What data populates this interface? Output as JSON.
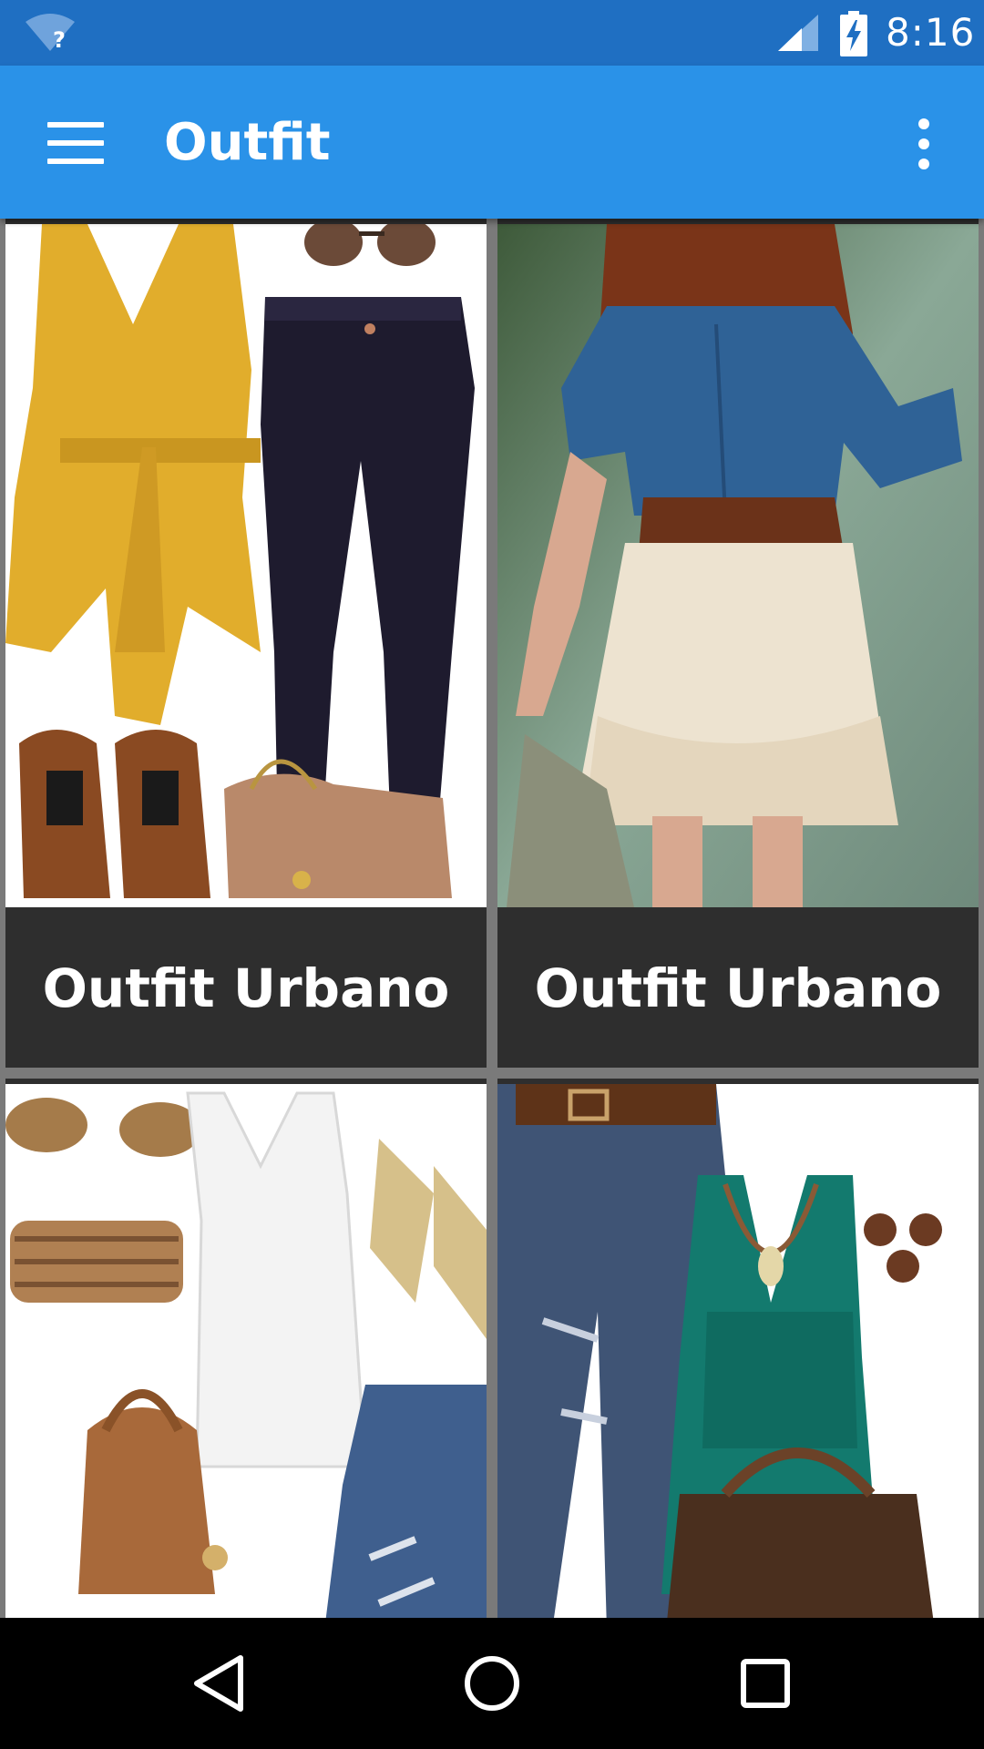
{
  "status_bar": {
    "time": "8:16",
    "icons": [
      "wifi-unknown-icon",
      "cell-signal-icon",
      "battery-charging-icon"
    ]
  },
  "app_bar": {
    "title": "Outfit",
    "menu_icon": "hamburger-menu-icon",
    "overflow_icon": "more-vert-icon"
  },
  "grid": {
    "cards": [
      {
        "caption": "Outfit Urbano",
        "image": "outfit-photo-yellow-top-jeans"
      },
      {
        "caption": "Outfit Urbano",
        "image": "outfit-photo-denim-shirt-tulle-skirt"
      },
      {
        "caption": "",
        "image": "outfit-photo-white-tank-ripped-jeans"
      },
      {
        "caption": "",
        "image": "outfit-photo-teal-blouse-jeans"
      }
    ]
  },
  "nav_bar": {
    "icons": [
      "back-icon",
      "home-icon",
      "recent-apps-icon"
    ]
  },
  "colors": {
    "status_bar": "#1f6fc2",
    "app_bar": "#2a92e8",
    "caption_bg": "#2e2e2e",
    "grid_gap": "#7a7a7a"
  }
}
